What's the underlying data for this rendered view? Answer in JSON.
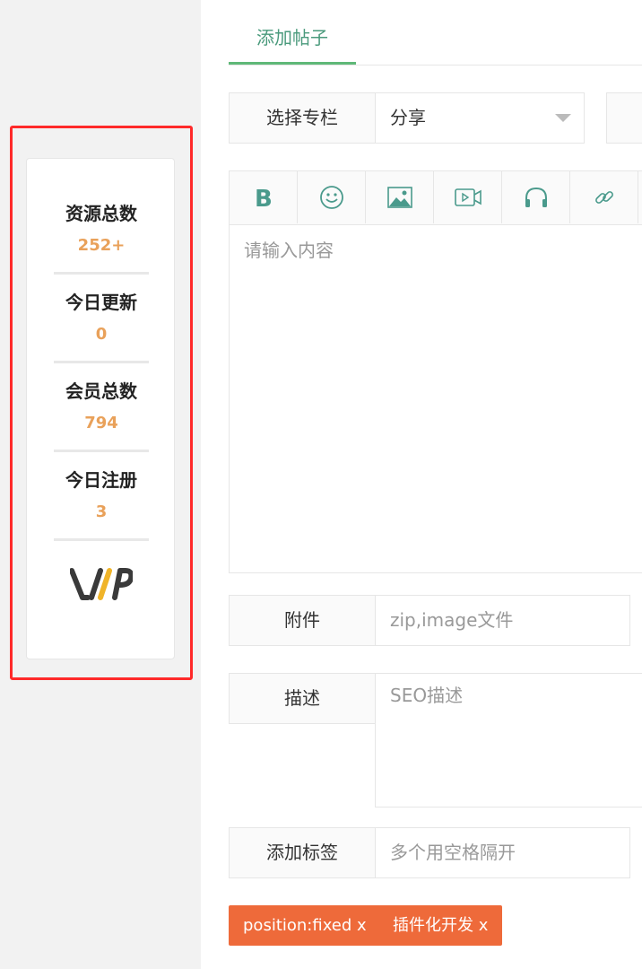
{
  "stats": [
    {
      "label": "资源总数",
      "value": "252+"
    },
    {
      "label": "今日更新",
      "value": "0"
    },
    {
      "label": "会员总数",
      "value": "794"
    },
    {
      "label": "今日注册",
      "value": "3"
    }
  ],
  "vip_logo_text": "VIP",
  "tabs": [
    {
      "label": "添加帖子"
    }
  ],
  "form": {
    "column_label": "选择专栏",
    "column_value": "分享",
    "editor_placeholder": "请输入内容",
    "attachment_label": "附件",
    "attachment_placeholder": "zip,image文件",
    "description_label": "描述",
    "description_placeholder": "SEO描述",
    "tags_label": "添加标签",
    "tags_placeholder": "多个用空格隔开"
  },
  "tags": [
    {
      "label": "position:fixed x"
    },
    {
      "label": "插件化开发 x"
    }
  ],
  "colors": {
    "accent_green": "#5fb878",
    "stat_value": "#e9a15a",
    "tag_bg": "#ee6a3a",
    "highlight": "#ff2a2a"
  },
  "toolbar_icons": [
    "bold-icon",
    "emoji-icon",
    "image-icon",
    "video-icon",
    "audio-icon",
    "link-icon"
  ]
}
